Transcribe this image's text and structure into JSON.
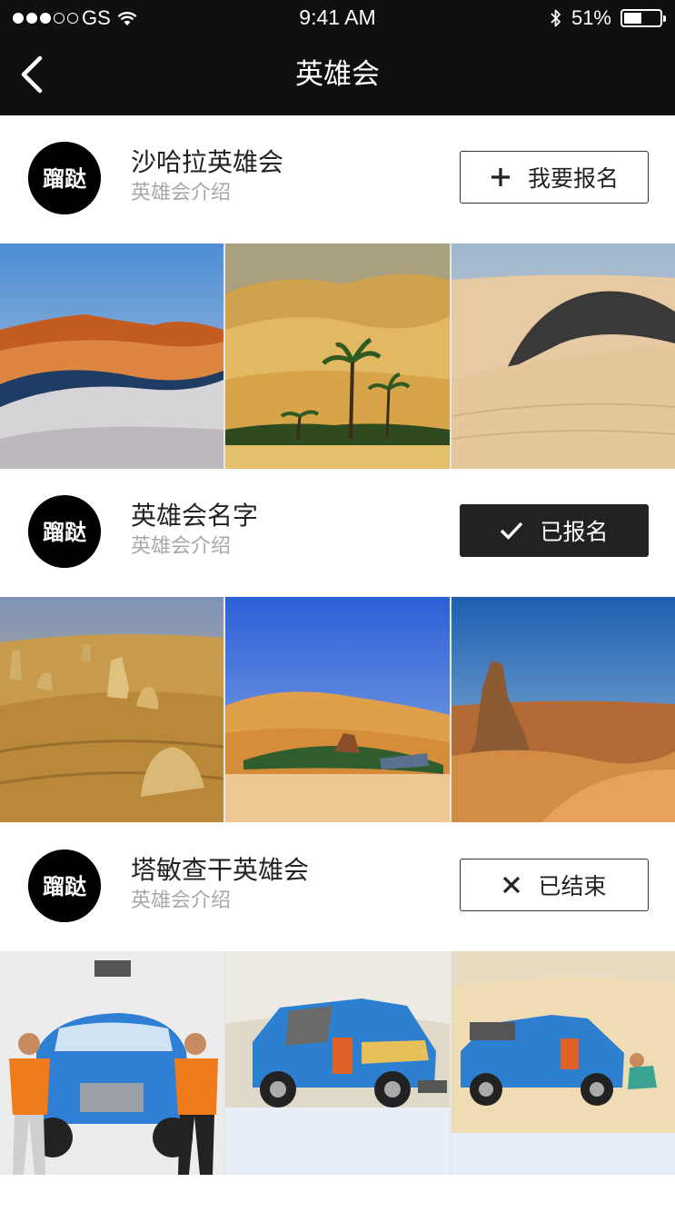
{
  "status_bar": {
    "carrier": "GS",
    "time": "9:41 AM",
    "battery": "51%",
    "battery_level": 0.51,
    "signal_bars_filled": 3,
    "signal_bars_total": 5
  },
  "nav": {
    "title": "英雄会",
    "back_icon": "chevron-left-icon"
  },
  "clubs": [
    {
      "name": "沙哈拉英雄会",
      "description": "英雄会介绍",
      "action": {
        "label": "我要报名",
        "icon": "plus-icon",
        "style": "outline"
      },
      "photos": [
        "sunset-dunes",
        "desert-palms",
        "dark-dune-ridge"
      ]
    },
    {
      "name": "英雄会名字",
      "description": "英雄会介绍",
      "action": {
        "label": "已报名",
        "icon": "check-icon",
        "style": "filled"
      },
      "photos": [
        "pinnacles-desert",
        "crescent-lake-oasis",
        "rock-pillar-dunes"
      ]
    },
    {
      "name": "塔敏查干英雄会",
      "description": "英雄会介绍",
      "action": {
        "label": "已结束",
        "icon": "close-icon",
        "style": "outline"
      },
      "photos": [
        "racers-with-truck",
        "blue-rally-truck",
        "rally-truck-sand"
      ]
    }
  ],
  "colors": {
    "header_bg": "#0f0f0f",
    "text_primary": "#222222",
    "text_secondary": "#a8a8a8",
    "button_dark": "#222222"
  }
}
